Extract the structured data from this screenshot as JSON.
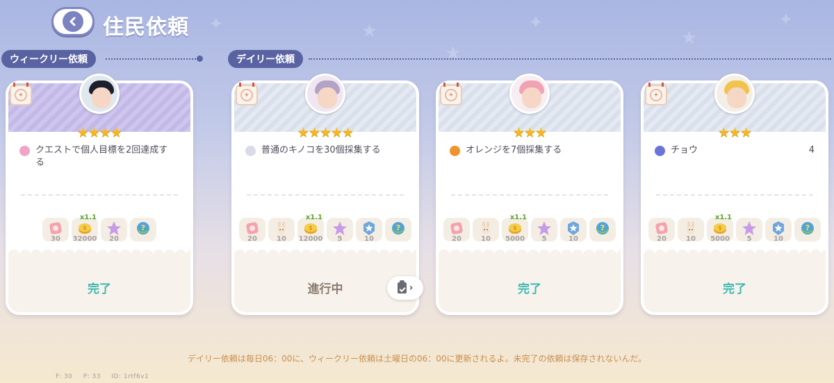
{
  "header": {
    "title": "住民依頼",
    "back_icon": "chevron-left-icon"
  },
  "sections": {
    "weekly_label": "ウィークリー依頼",
    "daily_label": "デイリー依頼"
  },
  "cards": [
    {
      "type": "weekly",
      "stars": "★★★★",
      "star_count": 4,
      "quest_text": "クエストで個人目標を2回達成する",
      "quest_count": "",
      "quest_icon_color": "#f2a3c8",
      "avatar_hair": "#1e1f2c",
      "avatar_bg": "#dfe8ee",
      "rewards": [
        {
          "icon": "ticket-icon",
          "count": "30",
          "badge": ""
        },
        {
          "icon": "coin-icon",
          "count": "32000",
          "badge": "x1.1"
        },
        {
          "icon": "star-icon",
          "count": "20",
          "badge": ""
        },
        {
          "icon": "mystery-egg-icon",
          "count": "",
          "badge": ""
        }
      ],
      "status": "完了",
      "status_type": "done"
    },
    {
      "type": "daily",
      "stars": "★★★★★",
      "star_count": 5,
      "quest_text": "普通のキノコを30個採集する",
      "quest_count": "",
      "quest_icon_color": "#d9dbe6",
      "avatar_hair": "#b3a3c4",
      "avatar_bg": "#efe6f2",
      "rewards": [
        {
          "icon": "ticket-icon",
          "count": "20",
          "badge": ""
        },
        {
          "icon": "bunny-icon",
          "count": "10",
          "badge": ""
        },
        {
          "icon": "coin-icon",
          "count": "12000",
          "badge": "x1.1"
        },
        {
          "icon": "star-icon",
          "count": "5",
          "badge": ""
        },
        {
          "icon": "badge-icon",
          "count": "10",
          "badge": ""
        },
        {
          "icon": "mystery-egg-icon",
          "count": "",
          "badge": ""
        }
      ],
      "status": "進行中",
      "status_type": "progress"
    },
    {
      "type": "daily",
      "stars": "★★★",
      "star_count": 3,
      "quest_text": "オレンジを7個採集する",
      "quest_count": "",
      "quest_icon_color": "#f0922d",
      "avatar_hair": "#f1a3b4",
      "avatar_bg": "#f6eef2",
      "rewards": [
        {
          "icon": "ticket-icon",
          "count": "20",
          "badge": ""
        },
        {
          "icon": "bunny-icon",
          "count": "10",
          "badge": ""
        },
        {
          "icon": "coin-icon",
          "count": "5000",
          "badge": "x1.1"
        },
        {
          "icon": "star-icon",
          "count": "5",
          "badge": ""
        },
        {
          "icon": "badge-icon",
          "count": "10",
          "badge": ""
        },
        {
          "icon": "mystery-egg-icon",
          "count": "",
          "badge": ""
        }
      ],
      "status": "完了",
      "status_type": "done"
    },
    {
      "type": "daily",
      "stars": "★★★",
      "star_count": 3,
      "quest_text": "チョウ",
      "quest_count": "4",
      "quest_icon_color": "#6a74d8",
      "avatar_hair": "#f0c34e",
      "avatar_bg": "#f3efe6",
      "rewards": [
        {
          "icon": "ticket-icon",
          "count": "20",
          "badge": ""
        },
        {
          "icon": "bunny-icon",
          "count": "10",
          "badge": ""
        },
        {
          "icon": "coin-icon",
          "count": "5000",
          "badge": "x1.1"
        },
        {
          "icon": "star-icon",
          "count": "5",
          "badge": ""
        },
        {
          "icon": "badge-icon",
          "count": "10",
          "badge": ""
        },
        {
          "icon": "mystery-egg-icon",
          "count": "",
          "badge": ""
        }
      ],
      "status": "完了",
      "status_type": "done"
    }
  ],
  "notice": "デイリー依頼は毎日06：00に、ウィークリー依頼は土曜日の06：00に更新されるよ。未完了の依頼は保存されないんだ。",
  "debug": {
    "f": "F: 30",
    "p": "P: 33",
    "id": "ID: 1rtf6v1"
  },
  "colors": {
    "accent": "#5a63a2",
    "done": "#3db9b1",
    "progress": "#8b7b6c",
    "star": "#f7b81f"
  }
}
